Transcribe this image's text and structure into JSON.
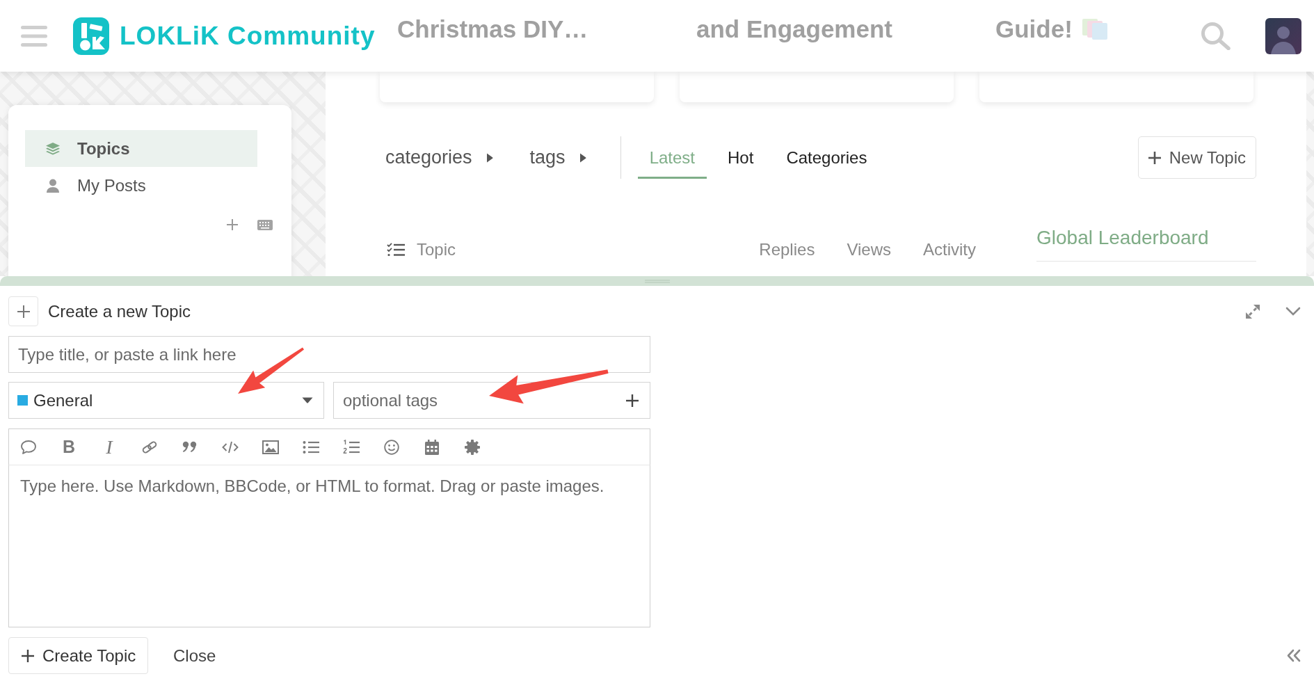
{
  "header": {
    "brand": "LOKLiK Community",
    "featured_titles": [
      "Christmas DIY…",
      "and Engagement",
      "Guide!"
    ]
  },
  "sidebar": {
    "items": [
      {
        "label": "Topics",
        "selected": true
      },
      {
        "label": "My Posts",
        "selected": false
      }
    ]
  },
  "navigation": {
    "dropdowns": [
      "categories",
      "tags"
    ],
    "tabs": [
      {
        "label": "Latest",
        "selected": true
      },
      {
        "label": "Hot",
        "selected": false
      },
      {
        "label": "Categories",
        "selected": false
      }
    ],
    "new_topic_button": "New Topic"
  },
  "topic_list": {
    "columns": [
      "Topic",
      "Replies",
      "Views",
      "Activity"
    ]
  },
  "leaderboard": {
    "title": "Global Leaderboard"
  },
  "composer": {
    "title": "Create a new Topic",
    "title_field": {
      "placeholder": "Type title, or paste a link here"
    },
    "category": {
      "value": "General",
      "color": "#29abe2"
    },
    "tags_field": {
      "placeholder": "optional tags"
    },
    "toolbar_glyphs": [
      "B",
      "I"
    ],
    "editor": {
      "placeholder": "Type here. Use Markdown, BBCode, or HTML to format. Drag or paste images."
    },
    "actions": [
      {
        "label": "Create Topic",
        "kind": "primary"
      },
      {
        "label": "Close",
        "kind": "link"
      }
    ]
  }
}
